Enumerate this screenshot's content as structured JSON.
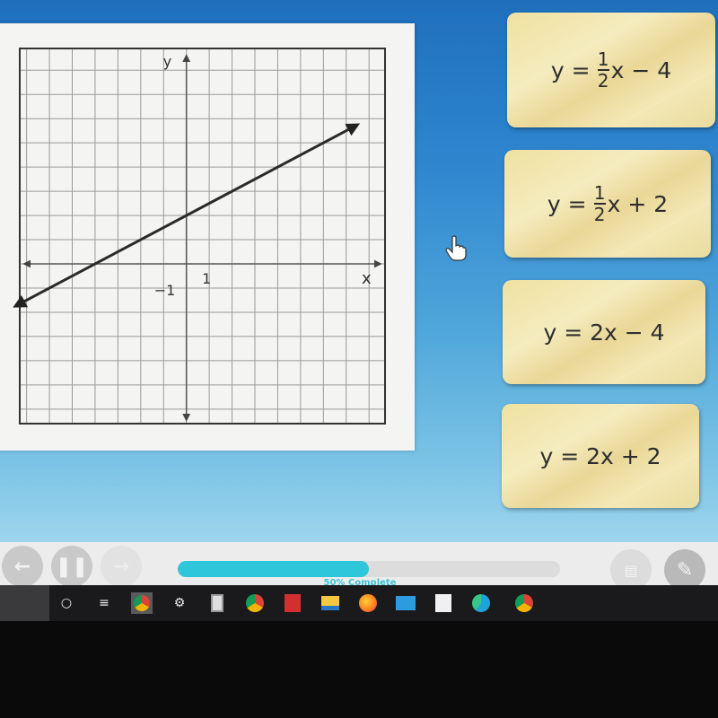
{
  "graph": {
    "x_axis_label": "x",
    "y_axis_label": "y",
    "tick_label_x": "1",
    "tick_label_y": "−1",
    "x_range": [
      -8,
      8
    ],
    "y_range": [
      -7,
      8
    ],
    "line": {
      "slope": 0.5,
      "intercept": 2,
      "x_start": -7.5,
      "x_end": 7.5
    }
  },
  "cards": [
    {
      "prefix": "y =",
      "numerator": "1",
      "denominator": "2",
      "suffix": "x − 4"
    },
    {
      "prefix": "y =",
      "numerator": "1",
      "denominator": "2",
      "suffix": "x + 2"
    },
    {
      "prefix": "y = 2x − 4"
    },
    {
      "prefix": "y = 2x + 2"
    }
  ],
  "player": {
    "back_icon": "arrow-left-icon",
    "pause_icon": "pause-icon",
    "forward_icon": "arrow-right-icon",
    "progress_percent": 50,
    "progress_label": "50% Complete",
    "glossary_icon": "book-icon",
    "notes_icon": "pencil-icon"
  },
  "taskbar": {
    "icons": [
      "search-icon",
      "task-view-icon",
      "chrome-profile-icon",
      "settings-icon",
      "calculator-icon",
      "chrome-icon",
      "acrobat-icon",
      "file-explorer-icon",
      "firefox-icon",
      "mail-icon",
      "store-icon",
      "edge-icon",
      "chrome-alt-icon"
    ]
  }
}
